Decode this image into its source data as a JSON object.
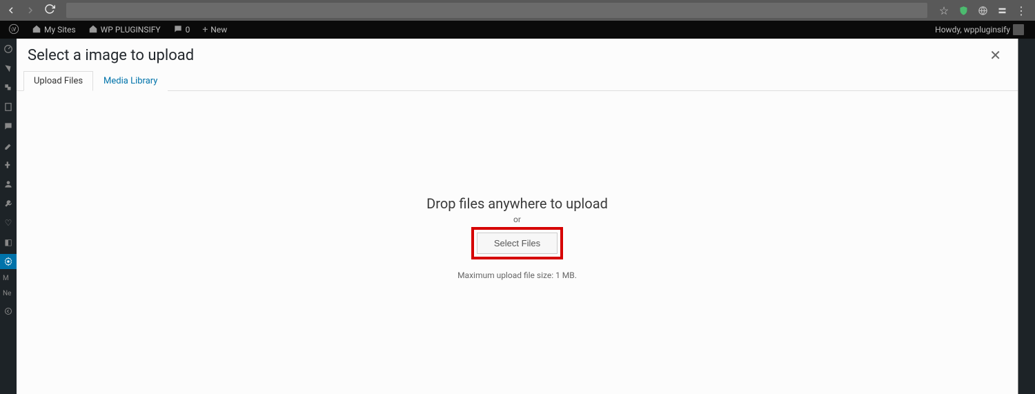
{
  "browser": {
    "url_hint": ""
  },
  "wp_bar": {
    "my_sites": "My Sites",
    "site_name": "WP PLUGINSIFY",
    "comments_count": "0",
    "new_label": "New",
    "howdy": "Howdy, wppluginsify"
  },
  "sidebar": {
    "items_truncated": [
      "M",
      "Ne"
    ]
  },
  "modal": {
    "title": "Select a image to upload",
    "tabs": {
      "upload": "Upload Files",
      "media": "Media Library"
    },
    "upload": {
      "drop_text": "Drop files anywhere to upload",
      "or_text": "or",
      "select_button": "Select Files",
      "max_text": "Maximum upload file size: 1 MB."
    }
  }
}
